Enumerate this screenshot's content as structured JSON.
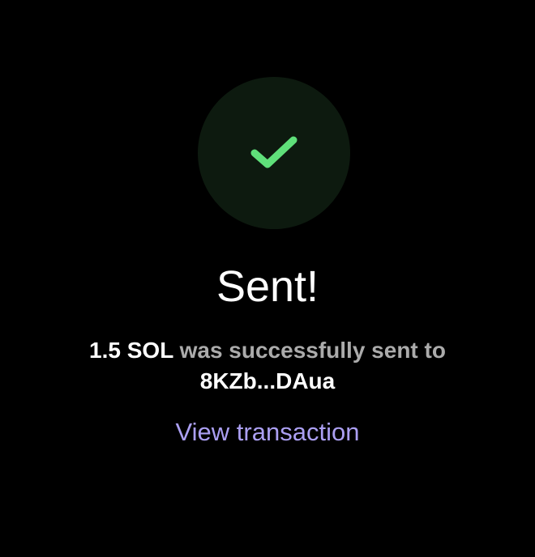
{
  "status": {
    "icon": "checkmark-icon",
    "title": "Sent!"
  },
  "message": {
    "amount": "1.5 SOL",
    "middle": " was successfully sent to",
    "recipient": "8KZb...DAua"
  },
  "actions": {
    "view_transaction_label": "View transaction"
  },
  "colors": {
    "background": "#000000",
    "circle": "#0d1a0f",
    "check": "#5fe07a",
    "link": "#ab9ff2",
    "muted_text": "#ababab"
  }
}
